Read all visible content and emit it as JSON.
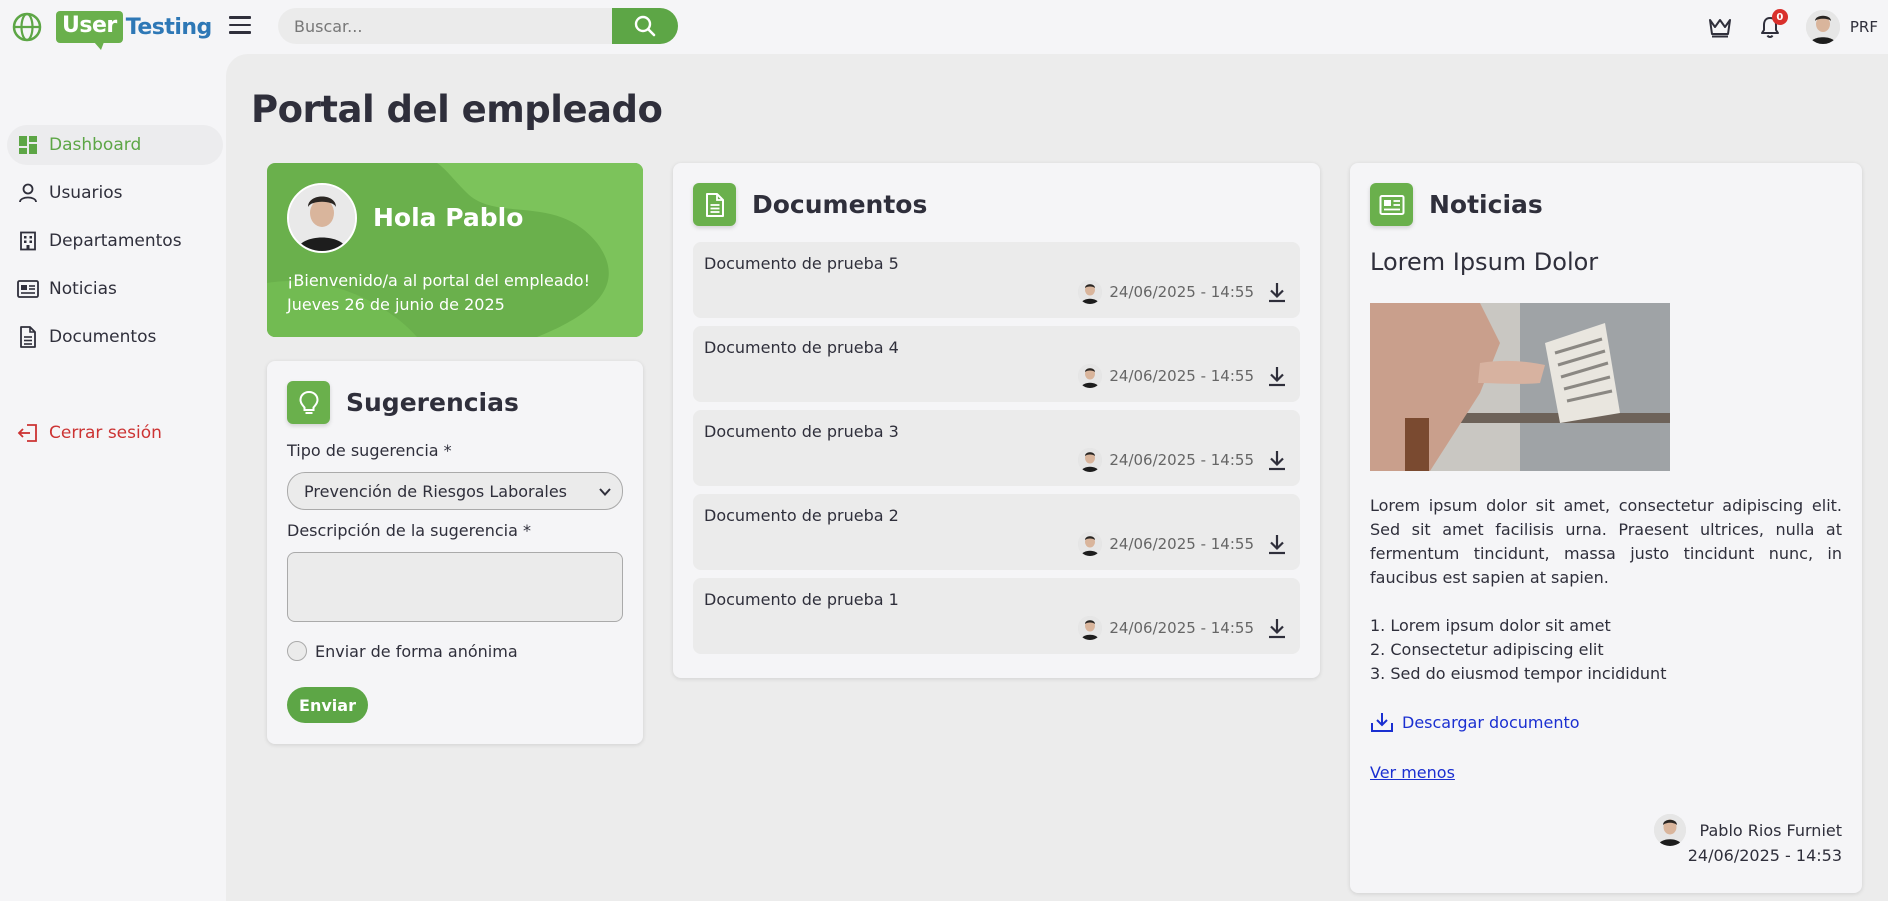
{
  "app": {
    "logo_part1": "User",
    "logo_part2": "Testing"
  },
  "search": {
    "placeholder": "Buscar..."
  },
  "topbar": {
    "notifications_count": "0",
    "user_initials": "PRF"
  },
  "sidebar": {
    "items": [
      {
        "label": "Dashboard",
        "icon": "dashboard-icon",
        "active": true
      },
      {
        "label": "Usuarios",
        "icon": "user-icon"
      },
      {
        "label": "Departamentos",
        "icon": "building-icon"
      },
      {
        "label": "Noticias",
        "icon": "newspaper-icon"
      },
      {
        "label": "Documentos",
        "icon": "document-icon"
      }
    ],
    "logout": {
      "label": "Cerrar sesión",
      "icon": "logout-icon"
    }
  },
  "main": {
    "title": "Portal del empleado"
  },
  "welcome": {
    "greeting": "Hola Pablo",
    "line1": "¡Bienvenido/a al portal del empleado!",
    "line2": "Jueves 26 de junio de 2025"
  },
  "suggestions": {
    "title": "Sugerencias",
    "type_label": "Tipo de sugerencia *",
    "type_value": "Prevención de Riesgos Laborales",
    "description_label": "Descripción de la sugerencia *",
    "anonymous_label": "Enviar de forma anónima",
    "submit_label": "Enviar"
  },
  "documents": {
    "title": "Documentos",
    "items": [
      {
        "name": "Documento de prueba 5",
        "date": "24/06/2025 - 14:55"
      },
      {
        "name": "Documento de prueba 4",
        "date": "24/06/2025 - 14:55"
      },
      {
        "name": "Documento de prueba 3",
        "date": "24/06/2025 - 14:55"
      },
      {
        "name": "Documento de prueba 2",
        "date": "24/06/2025 - 14:55"
      },
      {
        "name": "Documento de prueba 1",
        "date": "24/06/2025 - 14:55"
      }
    ]
  },
  "news": {
    "title": "Noticias",
    "headline": "Lorem Ipsum Dolor",
    "body": "Lorem ipsum dolor sit amet, consectetur adipiscing elit. Sed sit amet facilisis urna. Praesent ultrices, nulla at fermentum tincidunt, massa justo tincidunt nunc, in faucibus est sapien at sapien.",
    "list": [
      "1. Lorem ipsum dolor sit amet",
      "2. Consectetur adipiscing elit",
      "3. Sed do eiusmod tempor incididunt"
    ],
    "download_label": "Descargar documento",
    "less_label": "Ver menos",
    "author": "Pablo Rios Furniet",
    "date": "24/06/2025 - 14:53"
  },
  "colors": {
    "brand_green": "#6ab04c",
    "brand_blue": "#2e78b6",
    "link_blue": "#1a2fd1",
    "danger_red": "#cc3333"
  }
}
